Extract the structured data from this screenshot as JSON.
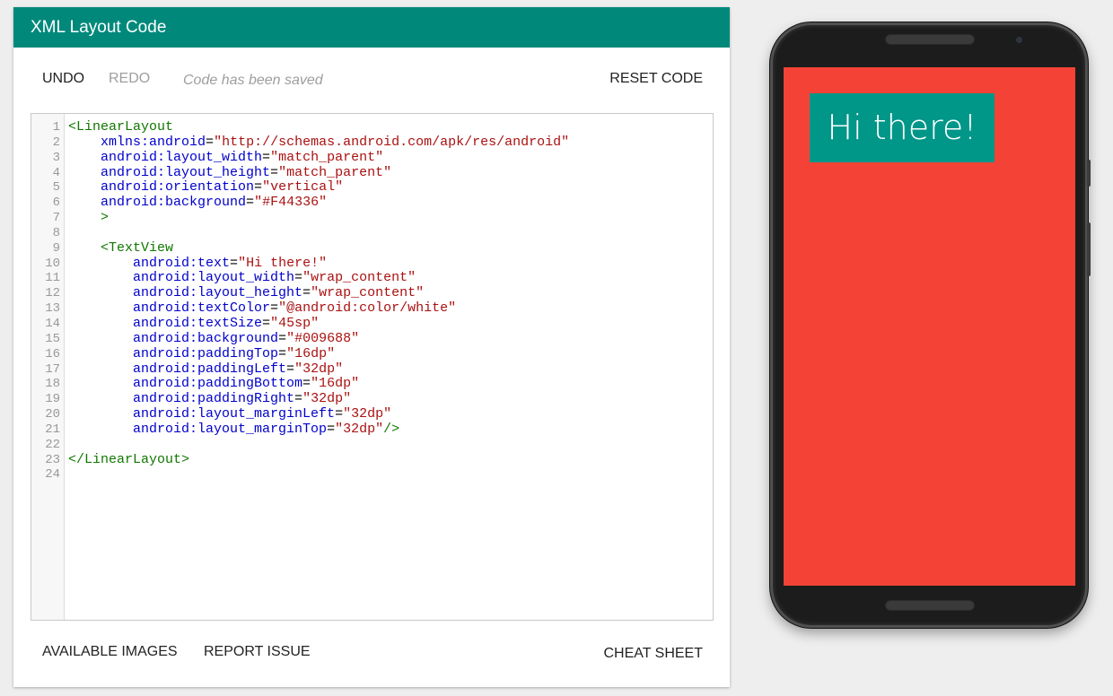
{
  "header": {
    "title": "XML Layout Code"
  },
  "toolbar": {
    "undo_label": "UNDO",
    "redo_label": "REDO",
    "status_text": "Code has been saved",
    "reset_label": "RESET CODE"
  },
  "editor": {
    "line_numbers": [
      "1",
      "2",
      "3",
      "4",
      "5",
      "6",
      "7",
      "8",
      "9",
      "10",
      "11",
      "12",
      "13",
      "14",
      "15",
      "16",
      "17",
      "18",
      "19",
      "20",
      "21",
      "22",
      "23",
      "24"
    ],
    "lines": [
      [
        {
          "t": "tg",
          "v": "<LinearLayout"
        }
      ],
      [
        {
          "t": "p",
          "v": "    "
        },
        {
          "t": "at",
          "v": "xmlns:android"
        },
        {
          "t": "p",
          "v": "="
        },
        {
          "t": "st",
          "v": "\"http://schemas.android.com/apk/res/android\""
        }
      ],
      [
        {
          "t": "p",
          "v": "    "
        },
        {
          "t": "at",
          "v": "android:layout_width"
        },
        {
          "t": "p",
          "v": "="
        },
        {
          "t": "st",
          "v": "\"match_parent\""
        }
      ],
      [
        {
          "t": "p",
          "v": "    "
        },
        {
          "t": "at",
          "v": "android:layout_height"
        },
        {
          "t": "p",
          "v": "="
        },
        {
          "t": "st",
          "v": "\"match_parent\""
        }
      ],
      [
        {
          "t": "p",
          "v": "    "
        },
        {
          "t": "at",
          "v": "android:orientation"
        },
        {
          "t": "p",
          "v": "="
        },
        {
          "t": "st",
          "v": "\"vertical\""
        }
      ],
      [
        {
          "t": "p",
          "v": "    "
        },
        {
          "t": "at",
          "v": "android:background"
        },
        {
          "t": "p",
          "v": "="
        },
        {
          "t": "st",
          "v": "\"#F44336\""
        }
      ],
      [
        {
          "t": "p",
          "v": "    "
        },
        {
          "t": "tg",
          "v": ">"
        }
      ],
      [],
      [
        {
          "t": "p",
          "v": "    "
        },
        {
          "t": "tg",
          "v": "<TextView"
        }
      ],
      [
        {
          "t": "p",
          "v": "        "
        },
        {
          "t": "at",
          "v": "android:text"
        },
        {
          "t": "p",
          "v": "="
        },
        {
          "t": "st",
          "v": "\"Hi there!\""
        }
      ],
      [
        {
          "t": "p",
          "v": "        "
        },
        {
          "t": "at",
          "v": "android:layout_width"
        },
        {
          "t": "p",
          "v": "="
        },
        {
          "t": "st",
          "v": "\"wrap_content\""
        }
      ],
      [
        {
          "t": "p",
          "v": "        "
        },
        {
          "t": "at",
          "v": "android:layout_height"
        },
        {
          "t": "p",
          "v": "="
        },
        {
          "t": "st",
          "v": "\"wrap_content\""
        }
      ],
      [
        {
          "t": "p",
          "v": "        "
        },
        {
          "t": "at",
          "v": "android:textColor"
        },
        {
          "t": "p",
          "v": "="
        },
        {
          "t": "st",
          "v": "\"@android:color/white\""
        }
      ],
      [
        {
          "t": "p",
          "v": "        "
        },
        {
          "t": "at",
          "v": "android:textSize"
        },
        {
          "t": "p",
          "v": "="
        },
        {
          "t": "st",
          "v": "\"45sp\""
        }
      ],
      [
        {
          "t": "p",
          "v": "        "
        },
        {
          "t": "at",
          "v": "android:background"
        },
        {
          "t": "p",
          "v": "="
        },
        {
          "t": "st",
          "v": "\"#009688\""
        }
      ],
      [
        {
          "t": "p",
          "v": "        "
        },
        {
          "t": "at",
          "v": "android:paddingTop"
        },
        {
          "t": "p",
          "v": "="
        },
        {
          "t": "st",
          "v": "\"16dp\""
        }
      ],
      [
        {
          "t": "p",
          "v": "        "
        },
        {
          "t": "at",
          "v": "android:paddingLeft"
        },
        {
          "t": "p",
          "v": "="
        },
        {
          "t": "st",
          "v": "\"32dp\""
        }
      ],
      [
        {
          "t": "p",
          "v": "        "
        },
        {
          "t": "at",
          "v": "android:paddingBottom"
        },
        {
          "t": "p",
          "v": "="
        },
        {
          "t": "st",
          "v": "\"16dp\""
        }
      ],
      [
        {
          "t": "p",
          "v": "        "
        },
        {
          "t": "at",
          "v": "android:paddingRight"
        },
        {
          "t": "p",
          "v": "="
        },
        {
          "t": "st",
          "v": "\"32dp\""
        }
      ],
      [
        {
          "t": "p",
          "v": "        "
        },
        {
          "t": "at",
          "v": "android:layout_marginLeft"
        },
        {
          "t": "p",
          "v": "="
        },
        {
          "t": "st",
          "v": "\"32dp\""
        }
      ],
      [
        {
          "t": "p",
          "v": "        "
        },
        {
          "t": "at",
          "v": "android:layout_marginTop"
        },
        {
          "t": "p",
          "v": "="
        },
        {
          "t": "st",
          "v": "\"32dp\""
        },
        {
          "t": "tg",
          "v": "/>"
        }
      ],
      [],
      [
        {
          "t": "tg",
          "v": "</LinearLayout>"
        }
      ],
      []
    ]
  },
  "footer": {
    "images_label": "AVAILABLE IMAGES",
    "report_label": "REPORT ISSUE",
    "cheat_label": "CHEAT SHEET"
  },
  "preview": {
    "text": "Hi there!",
    "screen_color": "#F44336",
    "textview_color": "#009688",
    "text_color": "#ffffff"
  },
  "colors": {
    "header": "#00897b",
    "tag": "#117700",
    "attribute": "#0000cc",
    "string": "#aa1111"
  }
}
